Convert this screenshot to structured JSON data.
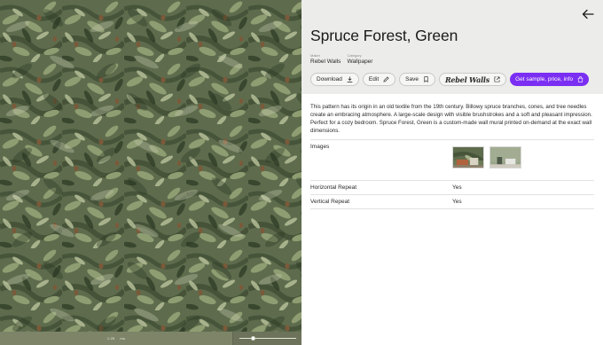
{
  "preview": {
    "scale_label": "1:25",
    "scale_unit": "ms",
    "zoom_level": 0.25
  },
  "header": {
    "back_icon": "arrow-left-icon",
    "title": "Spruce Forest, Green",
    "meta": [
      {
        "key": "Maker",
        "value": "Rebel Walls"
      },
      {
        "key": "Category",
        "value": "Wallpaper"
      }
    ],
    "actions": {
      "download_label": "Download",
      "edit_label": "Edit",
      "save_label": "Save",
      "brand_label": "Rebel Walls",
      "cta_label": "Get sample, price, info"
    }
  },
  "description": "This pattern has its origin in an old textile from the 19th century. Billowy spruce branches, cones, and tree needles create an embracing atmosphere. A large-scale design with visible brushstrokes and a soft and pleasant impression. Perfect for a cozy bedroom. Spruce Forest, Green is a custom-made wall mural printed on-demand at the exact wall dimensions.",
  "details": {
    "images_label": "Images",
    "rows": [
      {
        "label": "Horizontal Repeat",
        "value": "Yes"
      },
      {
        "label": "Vertical Repeat",
        "value": "Yes"
      }
    ]
  },
  "colors": {
    "accent": "#7b2ff2",
    "header_bg": "#ececea",
    "foliage_dark": "#3f5236",
    "foliage_light": "#a9b48d"
  }
}
